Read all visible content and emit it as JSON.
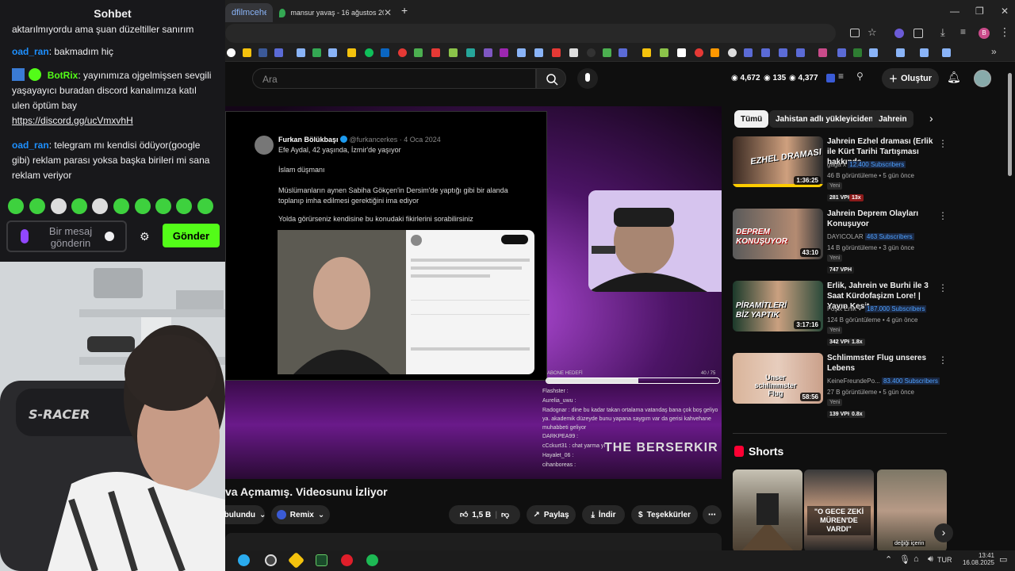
{
  "chat": {
    "title": "Sohbet",
    "cut_line": "aktarılmıyordu ama şuan düzeltiller sanırım",
    "messages": [
      {
        "user": "oad_ran",
        "text": ": bakmadım hiç"
      },
      {
        "user": "BotRix",
        "text": ": yayınımıza ojgelmişsen sevgili yaşayayıcı buradan discord kanalımıza katıl ulen öptüm bay",
        "link": "https://discord.gg/ucVmxvhH"
      },
      {
        "user": "oad_ran",
        "text": ": telegram mı kendisi ödüyor(google gibi) reklam parası yoksa başka birileri mi sana reklam veriyor"
      }
    ],
    "input_placeholder": "Bir mesaj gönderin",
    "send_label": "Gönder",
    "colors": {
      "username": "#1e90ff",
      "bot": "#53fc18",
      "send": "#53fc18"
    }
  },
  "browser": {
    "tabs": [
      {
        "label": "dfilmcehe"
      },
      {
        "label": "mansur yavaş - 16 ağustos 202"
      }
    ],
    "new_tab": "+"
  },
  "youtube": {
    "search_placeholder": "Ara",
    "stats": [
      "4,672",
      "135",
      "4,377"
    ],
    "create_label": "Oluştur",
    "video": {
      "title": "va Açmamış. Videosunu İzliyor",
      "tweet": {
        "name": "Furkan Bölükbaşı",
        "handle": "@furkancerkes · 4 Oca 2024",
        "line1": "Efe Aydal, 42 yaşında, İzmir'de yaşıyor",
        "line2": "İslam düşmanı",
        "line3": "Müslümanların aynen Sabiha Gökçen'in Dersim'de yaptığı gibi bir alanda toplanıp imha edilmesi gerektiğini ima ediyor",
        "line4": "Yolda görürseniz kendisine bu konudaki fikirlerini sorabilirsiniz"
      },
      "overlay_title": "ABONE HEDEFİ",
      "overlay_count": "40 / 75",
      "brand": "THE BERSERKIR",
      "overlay_chat": [
        "Flashster :",
        "Aurelia_uwu :",
        "Radognar : dine bu kadar takan ortalama vatandaş bana çok boş geliyo ya. akademik düzeyde bunu yapana saygım var da gerisi kahvehane muhabbeti geliyor",
        "DARKPEA99 :",
        "cCckurt31 : chat yarma yı",
        "Hayalet_06 :",
        "cihanboreas :"
      ]
    },
    "actions": {
      "subscribed": "bulundu",
      "remix": "Remix",
      "likes": "1,5 B",
      "share": "Paylaş",
      "download": "İndir",
      "thanks": "Teşekkürler"
    },
    "chips": [
      "Tümü",
      "Jahistan adlı yükleyiciden",
      "Jahrein"
    ],
    "recommendations": [
      {
        "title": "Jahrein Ezhel draması (Erlik ile Kürt Tarihi Tartışması hakkında...",
        "channel": "gaga x",
        "subs": "12.400 Subscribers",
        "meta": "46 B görüntüleme • 5 gün önce",
        "badge": "Yeni",
        "vph": "281 VPH",
        "mult": "13x",
        "duration": "1:36:25",
        "thumb_text": "EZHEL DRAMASI"
      },
      {
        "title": "Jahrein Deprem Olayları Konuşuyor",
        "channel": "DAYICOLAR",
        "subs": "463 Subscribers",
        "meta": "14 B görüntüleme • 3 gün önce",
        "badge": "Yeni",
        "vph": "747 VPH",
        "mult": "",
        "duration": "43:10",
        "thumb_text": "DEPREM KONUŞUYOR"
      },
      {
        "title": "Erlik, Jahrein ve Burhi ile 3 Saat Kürdofaşizm Lore! | Yayın Kesit",
        "channel": "Foşix Erlik",
        "subs": "187.000 Subscribers",
        "meta": "124 B görüntüleme • 4 gün önce",
        "badge": "Yeni",
        "vph": "342 VPH",
        "mult": "1.8x",
        "duration": "3:17:16",
        "thumb_text": "PİRAMİTLERİ BİZ YAPTIK"
      },
      {
        "title": "Schlimmster Flug unseres Lebens",
        "channel": "KeineFreundePo...",
        "subs": "83.400 Subscribers",
        "meta": "27 B görüntüleme • 5 gün önce",
        "badge": "Yeni",
        "vph": "139 VPH",
        "mult": "0.8x",
        "duration": "58:56",
        "thumb_text": "Unser schlimmster Flug"
      }
    ],
    "shorts_title": "Shorts",
    "shorts": [
      {
        "caption": ""
      },
      {
        "caption": "\"O GECE ZEKİ MÜREN'DE VARDI\""
      },
      {
        "caption": "değiği içerin"
      }
    ]
  },
  "webcam": {
    "chair_brand": "S-RACER"
  },
  "taskbar": {
    "lang": "TUR",
    "time": "13:41",
    "date": "16.08.2025"
  }
}
